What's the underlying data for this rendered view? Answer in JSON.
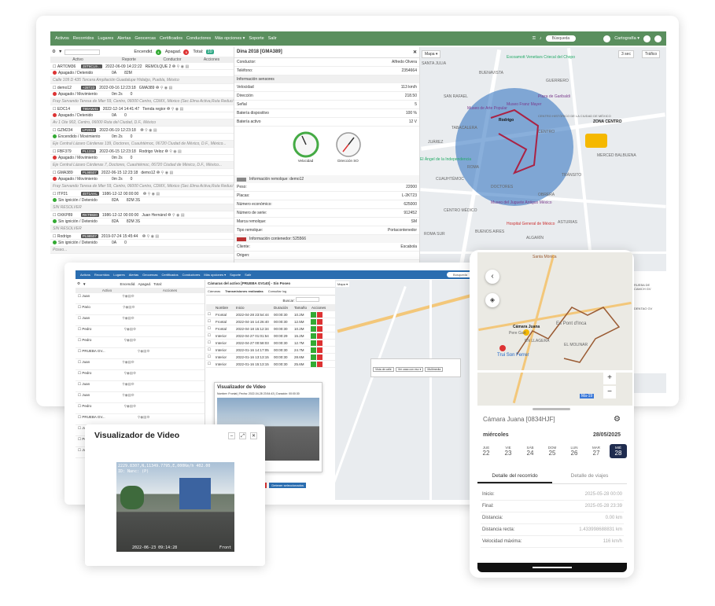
{
  "nav": {
    "items": [
      "Activos",
      "Recorridos",
      "Lugares",
      "Alertas",
      "Geocercas",
      "Certificados",
      "Conductores",
      "Más opciones ▾",
      "Soporte",
      "Salir"
    ],
    "search": "Búsqueda",
    "carto": "Cartografía ▾"
  },
  "filter": {
    "encendidos": "Encendid.",
    "enc_count": "4",
    "apagados": "Apagad.",
    "ap_count": "6",
    "total": "Total:",
    "total_count": "10"
  },
  "table": {
    "headers": [
      "Activo",
      "Reporte",
      "Conductor",
      "Acciones"
    ]
  },
  "assets": [
    {
      "name": "ARTOM36",
      "plate": "JST6CL9…",
      "date": "2022-06-09 14:22:22",
      "driver": "REMOLQUE 2",
      "status": "Apagado / Detenido",
      "s": "red",
      "speed": "0A",
      "ign": "82M",
      "addr": "Calle 109 D 435 Tercera Ampliación Guadalupe Hidalgo, Puebla, México"
    },
    {
      "name": "demo12",
      "plate": "+28T23",
      "date": "2022-09-16 12:23:18",
      "driver": "GMA389",
      "status": "Apagado / Movimiento",
      "s": "red",
      "speed": "0m 2s",
      "ign": "0",
      "addr": "Fray Servando Teresa de Mier 59, Centro, 06000 Centro, CDMX, México (Sec Elma Activa,Ruta Reduci Ang"
    },
    {
      "name": "EDC14",
      "plate": "T99AW41",
      "date": "2022-12-14 14:41:47",
      "driver": "Tienda regior",
      "status": "Apagado / Detenido",
      "s": "red",
      "speed": "0A",
      "ign": "0",
      "addr": "Av 1 Ote 902, Centro, 06000 Ruta del Ciudad, D.F., México"
    },
    {
      "name": "GZM234",
      "plate": "LP2010",
      "date": "2022-06-19 12:23:18",
      "driver": "",
      "status": "Encendido / Movimiento",
      "s": "grn",
      "speed": "0m 2s",
      "ign": "0",
      "addr": "Eje Central Lázaro Cárdenas 139, Doctores, Cuauhtémoc, 06720 Ciudad de México, D.F., México..."
    },
    {
      "name": "FBF379",
      "plate": "PL1234",
      "date": "2022-06-15 12:23:18",
      "driver": "Rodrigo Veloz",
      "status": "Apagado / Movimiento",
      "s": "red",
      "speed": "0m 2s",
      "ign": "0",
      "addr": "Eje Central Lázaro Cárdenas 7, Doctores, Cuauhtémoc, 06720 Ciudad de México, D.F., México..."
    },
    {
      "name": "GMA389",
      "plate": "PL98507",
      "date": "2022-06-15 12:23:18",
      "driver": "demo12",
      "status": "Apagado / Movimiento",
      "s": "red",
      "speed": "0m 2s",
      "ign": "0",
      "addr": "Fray Servando Teresa de Mier 59, Centro, 06000 Centro, CDMX, México (Sec Elma Activa,Ruta Reduci Ang"
    },
    {
      "name": "ITP21",
      "plate": "45T1AHL",
      "date": "1986-12-12 00:00:00",
      "driver": "",
      "status": "Sin ignición / Detenido",
      "s": "grn",
      "speed": "82A",
      "ign": "82M 3S",
      "addr": "SIN RESOLVER"
    },
    {
      "name": "OXKP89",
      "plate": "RKT9820",
      "date": "1986-12-12 00:00:00",
      "driver": "Juan Hernánd",
      "status": "Sin ignición / Detenido",
      "s": "grn",
      "speed": "82A",
      "ign": "82M 3S",
      "addr": "SIN RESOLVER"
    },
    {
      "name": "Rodrigo",
      "plate": "PL98507",
      "date": "2019-07-24 15:45:44",
      "driver": "",
      "status": "Sin ignición / Detenido",
      "s": "grn",
      "speed": "0A",
      "ign": "0",
      "addr": "Poseo..."
    }
  ],
  "detail": {
    "title": "Dina 2018 [GMA389]",
    "conductor": "Conductor:",
    "conductor_v": "Alfredo Olvera",
    "telefono": "Teléfono:",
    "telefono_v": "2354664",
    "sensor_title": "Información sensores",
    "sensors": [
      [
        "Velocidad",
        "113 km/h"
      ],
      [
        "Dirección",
        "218.50"
      ],
      [
        "Señal",
        "5"
      ],
      [
        "Batería dispositivo",
        "100 %"
      ],
      [
        "Batería activo",
        "12 V"
      ]
    ],
    "gauge1": "Velocidad",
    "gauge2": "Dirección SO",
    "remolque": "Información remolque: demo12",
    "rows": [
      [
        "Peso:",
        "22000"
      ],
      [
        "Placas:",
        "L-2KT23"
      ],
      [
        "Número económico:",
        "625000"
      ],
      [
        "Número de serie:",
        "912452"
      ],
      [
        "Marca remolque:",
        "SM"
      ],
      [
        "Tipo remolque:",
        "Portacontenedor"
      ]
    ],
    "contenedor": "Información contenedor: 525566",
    "rows2": [
      [
        "Cliente:",
        "Escabola"
      ],
      [
        "Origen:",
        ""
      ]
    ]
  },
  "map1": {
    "type": "Mapa ▾",
    "zoom": "3 sec",
    "traffic": "Tráfico",
    "labels": [
      "SANTA JULIA",
      "Escoamott Venetiars Criecal del Chopo",
      "SAN RAFAEL",
      "GUERRERO",
      "BUENAVISTA",
      "Museo de Arte Popular",
      "Plaza de Garibaldi",
      "TABACALERA",
      "Museo Franz Mayer",
      "CENTRO HISTÓRICO DE LA CIUDAD DE MÉXICO",
      "CENTRO",
      "Rodrigo",
      "JUÁREZ",
      "ZONA CENTRO",
      "El Ángel de la Independencia",
      "CUAUHTÉMOC",
      "ROMA",
      "TRÁNSITO",
      "MERCED BALBUENA",
      "DOCTORES",
      "OBRERA",
      "Museo del Juguete Antiguo México",
      "CENTRO MÉDICO",
      "ASTURIAS",
      "ROMA SUR",
      "BUENOS AIRES",
      "ALGARÍN",
      "Hospital General de México"
    ]
  },
  "panel": {
    "search_btn": "Búsqueda",
    "title": "Cámaras del activo [PRUEBA GV140] - Sin Poseo",
    "tabs": [
      "Cámaras",
      "Transmisiones realizadas",
      "Consultar log"
    ],
    "buscar": "Buscar:",
    "cols": [
      "",
      "Nombre",
      "Inicio",
      "Duración",
      "Tamaño",
      "Acciones"
    ],
    "rows": [
      [
        "Frontal",
        "2022-04-28 23:54:44",
        "00:00:30",
        "10.2M"
      ],
      [
        "Frontal",
        "2022-04-16 14:26:40",
        "00:00:30",
        "12.5M"
      ],
      [
        "Frontal",
        "2022-04-18 15:12:34",
        "00:00:30",
        "10.2M"
      ],
      [
        "Interior",
        "2022-04-27 01:01:54",
        "00:00:29",
        "15.2M"
      ],
      [
        "Interior",
        "2022-04-27 00:58:03",
        "00:00:30",
        "12.7M"
      ],
      [
        "Interior",
        "2022-01-16 14:17:05",
        "00:00:30",
        "24.7M"
      ],
      [
        "Interior",
        "2022-01-16 13:13:15",
        "00:00:30",
        "28.6M"
      ],
      [
        "Interior",
        "2022-01-16 15:13:15",
        "00:00:30",
        "25.6M"
      ]
    ],
    "inner_title": "Visualizador de Video",
    "inner_sub": "Nombre: Frontal | Fecha: 2022-04-28 23:54:43 | Duración: 00:00:30",
    "btn_red": "Cerrar",
    "btn_blue": "Detener seleccionados"
  },
  "small_assets": [
    "Juan",
    "Pario",
    "Juan",
    "Pedro",
    "Pedro",
    "PRUEBA GV...",
    "Juan",
    "Pedro",
    "Juan",
    "Juan",
    "Pedro",
    "PRUEBA GV...",
    "Juan",
    "Pedro",
    "Juan"
  ],
  "video": {
    "title": "Visualizador de Video",
    "overlay": "2229.8307,N,11349.7795,E,000Km/h 402.00",
    "overlay2": "ID: Nanc: (P)",
    "stamp": "2022-06-23 09:14:28",
    "cam": "Front"
  },
  "popup": {
    "buttons": [
      "Vista de calle",
      "Ver casa con eso ▾",
      "Multimedia"
    ]
  },
  "mobile": {
    "map_labels": [
      "Santa Mònica",
      "Cámara Juana",
      "Es Pont d'Inca",
      "EL MOLINAR",
      "Pere Gart",
      "Trui Son Ferrer",
      "EN LLAGERA",
      "Ma-19"
    ],
    "vehicle": "Cámara Juana",
    "plate": "[0834HJF]",
    "day": "miércoles",
    "date": "28/05/2025",
    "week": [
      [
        "JUE",
        "22"
      ],
      [
        "VIE",
        "23"
      ],
      [
        "SÁB",
        "24"
      ],
      [
        "DOM",
        "25"
      ],
      [
        "LUN",
        "26"
      ],
      [
        "MAR",
        "27"
      ],
      [
        "MIÉ",
        "28"
      ]
    ],
    "tabs": [
      "Detalle del recorrido",
      "Detalle de viajes"
    ],
    "rows": [
      [
        "Inicio:",
        "2025-05-28 00:00"
      ],
      [
        "Final:",
        "2025-05-28 23:39"
      ],
      [
        "Distancia:",
        "0.00 km"
      ],
      [
        "Distancia recta:",
        "1.433998688831 km"
      ],
      [
        "Velocidad máxima:",
        "116 km/h"
      ]
    ]
  },
  "right_strip": [
    "RUEBA DE",
    "CAMCH GV",
    "DENTAO GV"
  ]
}
